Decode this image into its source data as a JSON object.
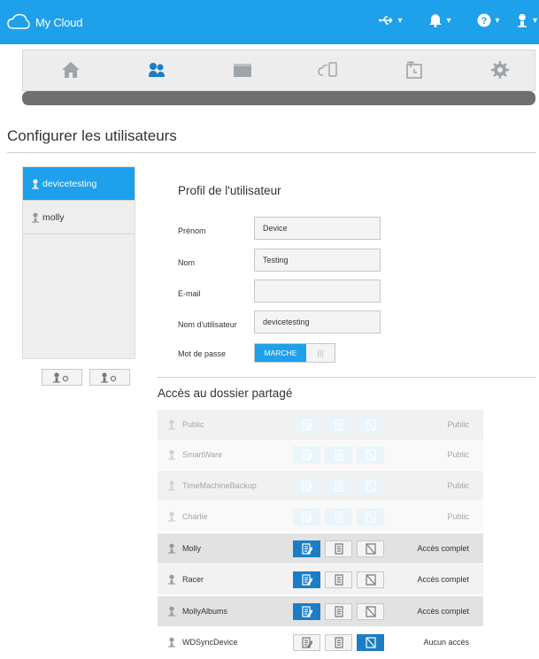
{
  "app": {
    "title": "My Cloud",
    "trademark": "™"
  },
  "topbar": {
    "icons": [
      {
        "name": "usb-icon",
        "caret": "▾"
      },
      {
        "name": "bell-icon",
        "caret": "▾"
      },
      {
        "name": "help-icon",
        "caret": "▾"
      },
      {
        "name": "user-icon",
        "caret": "▾"
      }
    ]
  },
  "nav": {
    "items": [
      "home-icon",
      "users-icon",
      "shares-icon",
      "cloud-access-icon",
      "backups-icon",
      "settings-icon"
    ],
    "active": "users-icon"
  },
  "page": {
    "title": "Configurer les utilisateurs"
  },
  "users": [
    {
      "name": "devicetesting",
      "active": true
    },
    {
      "name": "molly",
      "active": false
    }
  ],
  "profile": {
    "title": "Profil de l'utilisateur",
    "fields": {
      "first_name": {
        "label": "Prénom",
        "value": "Device"
      },
      "last_name": {
        "label": "Nom",
        "value": "Testing"
      },
      "email": {
        "label": "E-mail",
        "value": ""
      },
      "username": {
        "label": "Nom d'utilisateur",
        "value": "devicetesting"
      },
      "password": {
        "label": "Mot de passe",
        "toggle_on": "MARCHE",
        "toggle_off": "|||"
      }
    }
  },
  "shares": {
    "title": "Accès au dossier partagé",
    "rows": [
      {
        "name": "Public",
        "access": "Public",
        "selected": 0,
        "dim": true
      },
      {
        "name": "SmartWare",
        "access": "Public",
        "selected": 0,
        "dim": true
      },
      {
        "name": "TimeMachineBackup",
        "access": "Public",
        "selected": 0,
        "dim": true
      },
      {
        "name": "Charlie",
        "access": "Public",
        "selected": 0,
        "dim": true
      },
      {
        "name": "Molly",
        "access": "Accès complet",
        "selected": 1,
        "dim": false
      },
      {
        "name": "Racer",
        "access": "Accès complet",
        "selected": 1,
        "dim": false
      },
      {
        "name": "MollyAlbums",
        "access": "Accès complet",
        "selected": 1,
        "dim": false
      },
      {
        "name": "WDSyncDevice",
        "access": "Aucun accès",
        "selected": 3,
        "dim": false
      }
    ]
  },
  "colors": {
    "accent": "#1ea0ea",
    "selected": "#1a7dc6"
  }
}
